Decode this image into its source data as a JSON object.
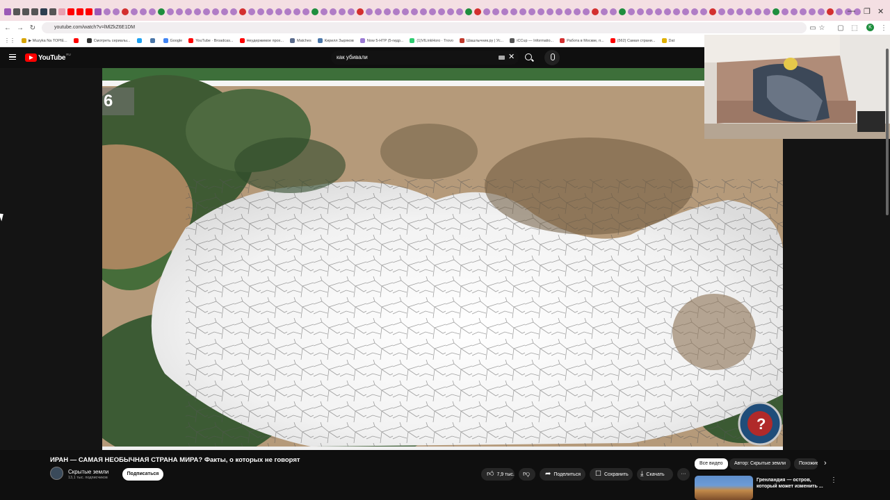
{
  "browser": {
    "url": "youtube.com/watch?v=lMlZkZ6E1DM",
    "bookmarks": [
      {
        "label": "▶ Muzyka Na TOPIE...",
        "color": "#d7a400"
      },
      {
        "label": "",
        "color": "#ff0000"
      },
      {
        "label": "Смотреть сериалы...",
        "color": "#333"
      },
      {
        "label": "",
        "color": "#1da1f2"
      },
      {
        "label": "",
        "color": "#4a76a8"
      },
      {
        "label": "Google",
        "color": "#4285f4"
      },
      {
        "label": "YouTube · Broadcas...",
        "color": "#ff0000"
      },
      {
        "label": "Неудержимое прох...",
        "color": "#ff0000"
      },
      {
        "label": "Matches",
        "color": "#5a6b8c"
      },
      {
        "label": "Кирилл Зыряков",
        "color": "#4a76a8"
      },
      {
        "label": "Now 5-HTP (5-гидр...",
        "color": "#9b7bd4"
      },
      {
        "label": "(1)VILinkHoro · Trovo",
        "color": "#2ecc71"
      },
      {
        "label": "Шашлычник.ру | Ус...",
        "color": "#c0392b"
      },
      {
        "label": "iCCup — Informatio...",
        "color": "#555"
      },
      {
        "label": "Работа в Москве, п...",
        "color": "#d32f2f"
      },
      {
        "label": "(562) Самая страни...",
        "color": "#ff0000"
      },
      {
        "label": "Dat",
        "color": "#e0b000"
      }
    ]
  },
  "header": {
    "logo": "YouTube",
    "region": "RU",
    "search_query": "как убивали"
  },
  "video": {
    "overlay_number": "6",
    "title": "ИРАН — САМАЯ НЕОБЫЧНАЯ СТРАНА МИРА? Факты, о которых не говорят",
    "channel": "Скрытые земли",
    "subscribers": "13,1 тыс. подписчиков",
    "subscribe_label": "Подписаться",
    "likes": "7,9 тыс.",
    "share_label": "Поделиться",
    "save_label": "Сохранить",
    "download_label": "Скачать"
  },
  "sidebar": {
    "chips": [
      "Все видео",
      "Автор: Скрытые земли",
      "Похожие"
    ],
    "recommendation_title": "Гренландия — остров, который может изменить ..."
  },
  "icons": [
    "menu-icon",
    "search-icon",
    "mic-icon",
    "like-icon",
    "dislike-icon",
    "share-icon",
    "save-icon",
    "download-icon",
    "more-icon",
    "chevron-right-icon"
  ]
}
